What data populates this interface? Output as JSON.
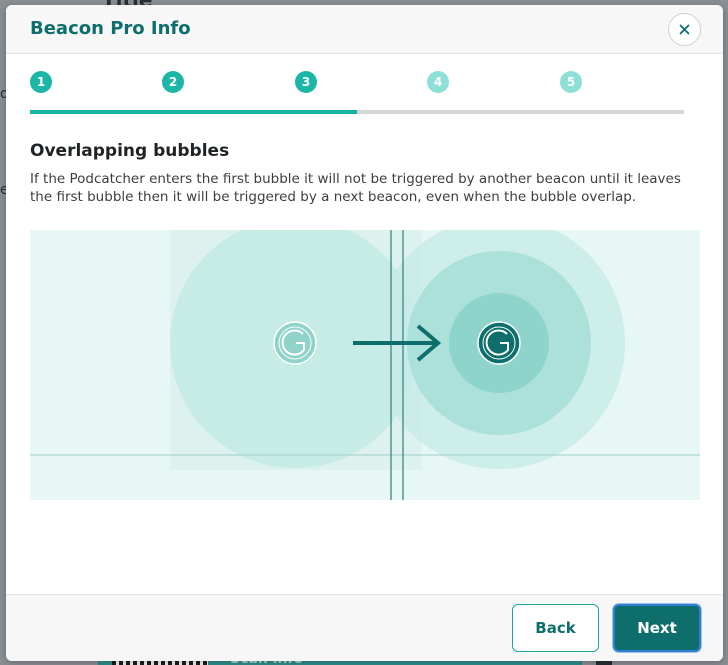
{
  "background": {
    "title_fragment": "Title",
    "bottom_label_fragment": "Scan info"
  },
  "modal": {
    "title": "Beacon Pro Info",
    "close_icon": "close-icon",
    "stepper": {
      "steps": [
        "1",
        "2",
        "3",
        "4",
        "5"
      ],
      "current_step": 3,
      "progress_fraction": 0.5
    },
    "heading": "Overlapping bubbles",
    "description": "If the Podcatcher enters the first bubble it will not be triggered by another beacon until it leaves the first bubble then it will be triggered by a next beacon, even when the bubble overlap.",
    "footer": {
      "back_label": "Back",
      "next_label": "Next"
    }
  },
  "colors": {
    "brand_teal": "#0d6e6c",
    "step_done": "#1cb6a6",
    "step_todo": "#8ddfd8",
    "bubble_fill": "#a8e0da"
  }
}
